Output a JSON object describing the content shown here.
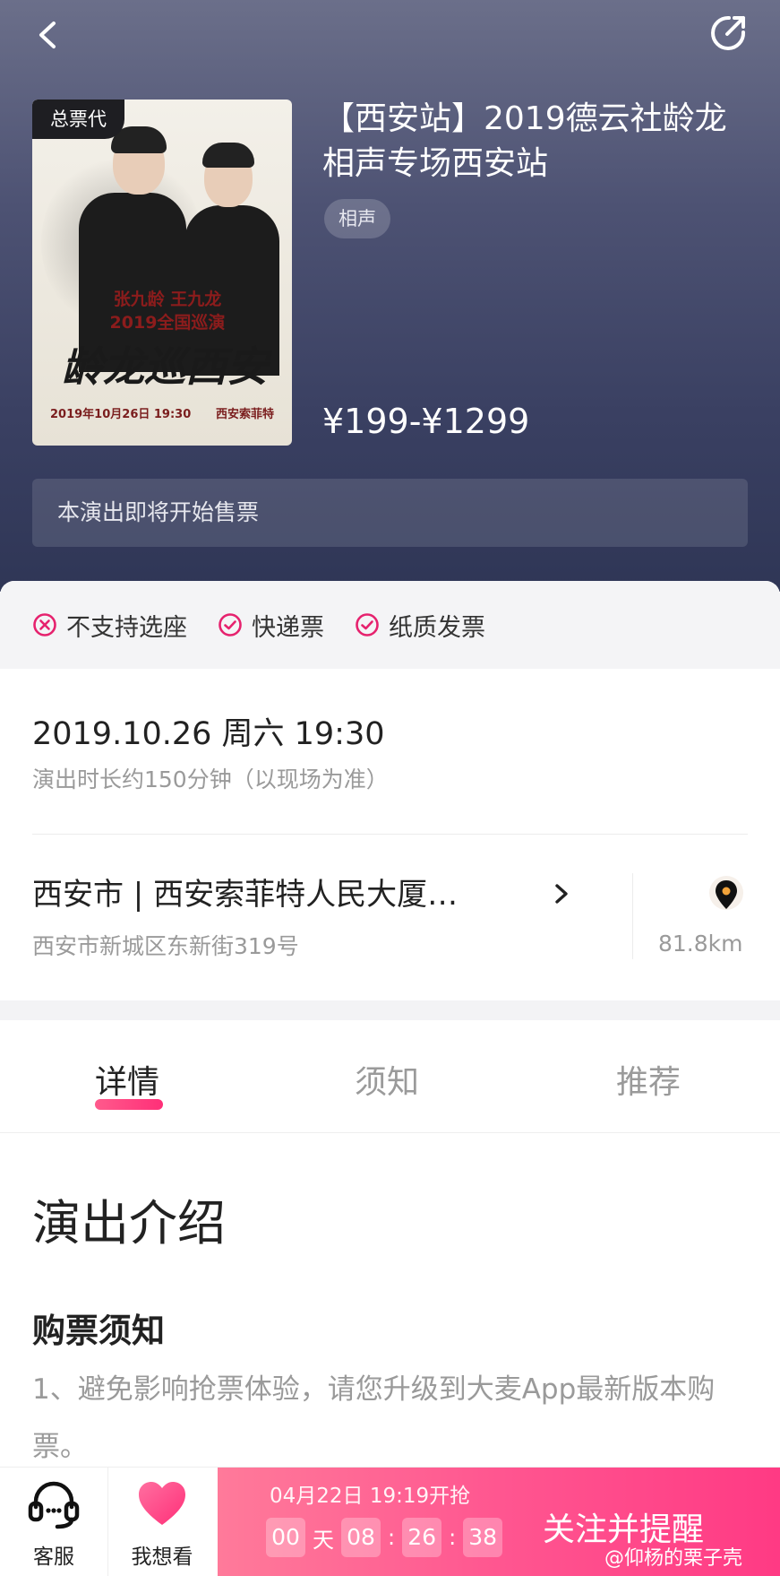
{
  "header": {
    "back_icon": "chevron-left-icon",
    "share_icon": "share-icon"
  },
  "poster": {
    "badge": "总票代",
    "names": "张九龄 王九龙\n2019全国巡演",
    "calligraphy": "龄龙巡西安",
    "date": "2019年10月26日 19:30",
    "venue": "西安索菲特"
  },
  "show": {
    "title": "【西安站】2019德云社龄龙相声专场西安站",
    "tag": "相声",
    "price": "¥199-¥1299",
    "notice": "本演出即将开始售票"
  },
  "features": [
    {
      "label": "不支持选座",
      "icon": "x-circle-icon"
    },
    {
      "label": "快递票",
      "icon": "check-circle-icon"
    },
    {
      "label": "纸质发票",
      "icon": "check-circle-icon"
    }
  ],
  "schedule": {
    "datetime": "2019.10.26 周六 19:30",
    "duration": "演出时长约150分钟（以现场为准）"
  },
  "venue": {
    "name": "西安市 | 西安索菲特人民大厦…",
    "address": "西安市新城区东新街319号",
    "distance": "81.8km"
  },
  "tabs": [
    "详情",
    "须知",
    "推荐"
  ],
  "content": {
    "section_title": "演出介绍",
    "sub_title": "购票须知",
    "body": "1、避免影响抢票体验，请您升级到大麦App最新版本购票。"
  },
  "bottom_bar": {
    "service_label": "客服",
    "want_label": "我想看",
    "sale_time": "04月22日 19:19开抢",
    "countdown": {
      "days": "00",
      "day_unit": "天",
      "hours": "08",
      "minutes": "26",
      "seconds": "38"
    },
    "cta_label": "关注并提醒"
  },
  "watermark": "@仰杨的栗子壳",
  "colors": {
    "accent": "#ff2f78",
    "hero_top": "#6b6f8a",
    "hero_bottom": "#2f3656"
  }
}
